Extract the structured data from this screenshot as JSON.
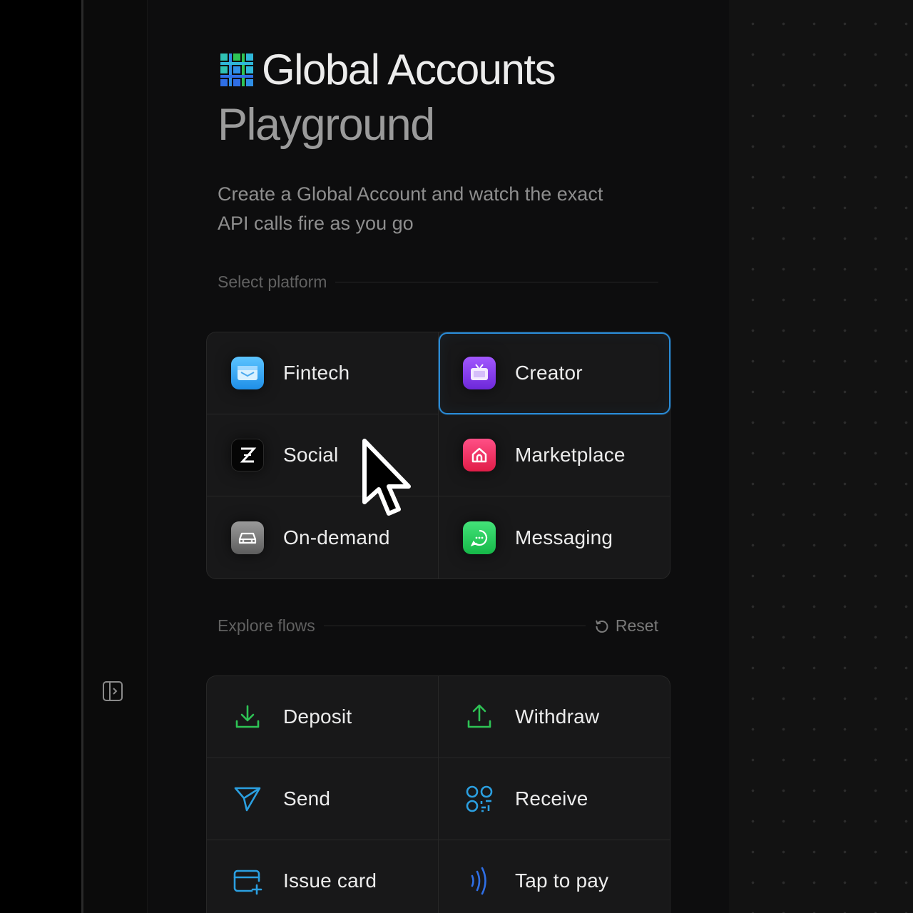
{
  "header": {
    "title": "Global Accounts",
    "subtitle": "Playground",
    "description": "Create a Global Account and watch the exact API calls fire as you go"
  },
  "platform_section": {
    "label": "Select platform",
    "items": [
      {
        "label": "Fintech",
        "icon": "wallet-icon",
        "color": "#2fa4f3"
      },
      {
        "label": "Creator",
        "icon": "tv-icon",
        "color": "#8a3df0",
        "selected": true
      },
      {
        "label": "Social",
        "icon": "z-logo-icon",
        "color": "#000000"
      },
      {
        "label": "Marketplace",
        "icon": "house-icon",
        "color": "#f0336a"
      },
      {
        "label": "On-demand",
        "icon": "car-icon",
        "color": "#7a7a7a"
      },
      {
        "label": "Messaging",
        "icon": "chat-bubble-icon",
        "color": "#22d158"
      }
    ]
  },
  "flows_section": {
    "label": "Explore flows",
    "reset_label": "Reset",
    "items": [
      {
        "label": "Deposit",
        "icon": "download-icon",
        "color": "#2ec455"
      },
      {
        "label": "Withdraw",
        "icon": "upload-icon",
        "color": "#2ec455"
      },
      {
        "label": "Send",
        "icon": "send-icon",
        "color": "#2b9fe0"
      },
      {
        "label": "Receive",
        "icon": "qr-code-icon",
        "color": "#2b9fe0"
      },
      {
        "label": "Issue card",
        "icon": "card-add-icon",
        "color": "#2b9fe0"
      },
      {
        "label": "Tap to pay",
        "icon": "contactless-icon",
        "color": "#2f6fe6"
      }
    ]
  },
  "colors": {
    "accent_selected": "#2a8bd6",
    "background": "#0d0d0e",
    "panel": "#181819"
  }
}
